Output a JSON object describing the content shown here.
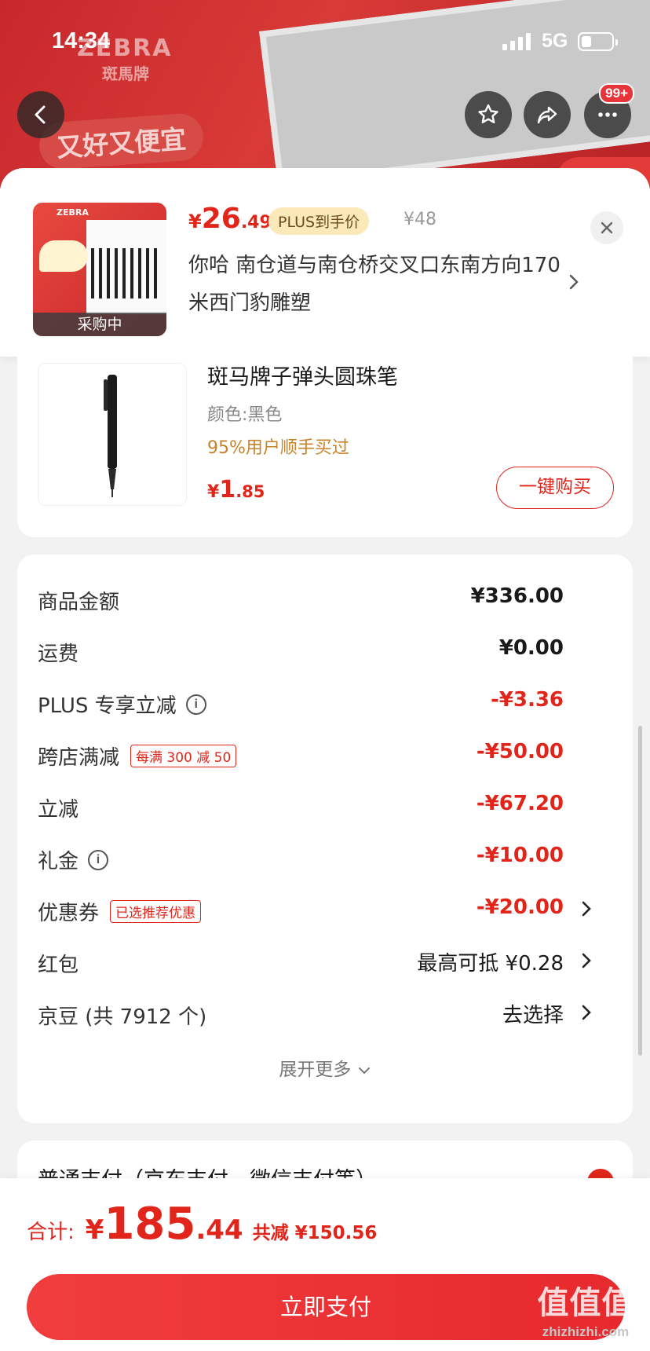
{
  "status_bar": {
    "time": "14:34",
    "network": "5G"
  },
  "banner": {
    "brand": "ZEBRA",
    "brand_cn": "斑馬牌",
    "slogan": "又好又便宜"
  },
  "nav": {
    "more_badge": "99+"
  },
  "floating_product": {
    "thumb_caption": "采购中",
    "price_currency": "¥",
    "price_int": "26",
    "price_dec": ".49",
    "plus_tag": "PLUS到手价",
    "original_price": "¥48",
    "address": "你哈  南仓道与南仓桥交叉口东南方向170米西门豹雕塑"
  },
  "recommendation": {
    "title": "斑马牌子弹头圆珠笔",
    "color": "颜色:黑色",
    "repurchase": "95%用户顺手买过",
    "price_currency": "¥",
    "price_int": "1",
    "price_dec": ".85",
    "buy_button": "一键购买"
  },
  "fees": {
    "rows": [
      {
        "label": "商品金额",
        "value": "¥336.00"
      },
      {
        "label": "运费",
        "value": "¥0.00"
      },
      {
        "label": "PLUS 专享立减",
        "value": "-¥3.36"
      },
      {
        "label": "跨店满减",
        "tag": "每满 300 减 50",
        "value": "-¥50.00"
      },
      {
        "label": "立减",
        "value": "-¥67.20"
      },
      {
        "label": "礼金",
        "value": "-¥10.00"
      },
      {
        "label": "优惠券",
        "tag": "已选推荐优惠",
        "value": "-¥20.00"
      },
      {
        "label": "红包",
        "value": "最高可抵 ¥0.28"
      },
      {
        "label": "京豆 (共 7912 个)",
        "value": "去选择"
      }
    ],
    "expand_more": "展开更多"
  },
  "payment_method": {
    "title": "普通支付（京东支付、微信支付等）"
  },
  "bottom_bar": {
    "total_label": "合计:",
    "total_currency": "¥",
    "total_int": "185",
    "total_dec": ".44",
    "total_saved": "共减 ¥150.56",
    "pay_button": "立即支付"
  },
  "watermark": {
    "line1": "值值值",
    "line2": "zhizhizhi.com"
  },
  "colors": {
    "accent_red": "#e1251b",
    "plus_gold": "#fbe9b9",
    "repurchase_orange": "#c8832a"
  }
}
